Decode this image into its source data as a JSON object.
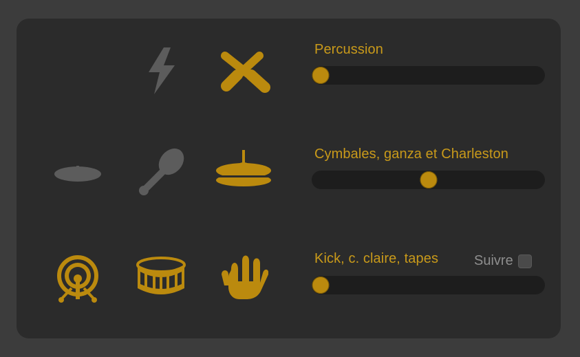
{
  "colors": {
    "accent": "#c99a1a",
    "inactive": "#5c5c5c",
    "track": "#1d1d1d",
    "panel": "#2b2b2b",
    "background": "#3c3c3c"
  },
  "icons": [
    {
      "name": "handclap-icon",
      "active": false
    },
    {
      "name": "shaker-icon",
      "active": true
    },
    {
      "name": "crash-cymbal-icon",
      "active": false
    },
    {
      "name": "maracas-icon",
      "active": false
    },
    {
      "name": "hihat-icon",
      "active": true
    },
    {
      "name": "kick-drum-icon",
      "active": true
    },
    {
      "name": "snare-drum-icon",
      "active": true
    },
    {
      "name": "hand-clap-icon",
      "active": true
    }
  ],
  "rows": [
    {
      "label": "Percussion",
      "slider_value": 0.0
    },
    {
      "label": "Cymbales, ganza et Charleston",
      "slider_value": 0.5
    },
    {
      "label": "Kick, c. claire, tapes",
      "slider_value": 0.0
    }
  ],
  "follow": {
    "label": "Suivre",
    "checked": false
  }
}
